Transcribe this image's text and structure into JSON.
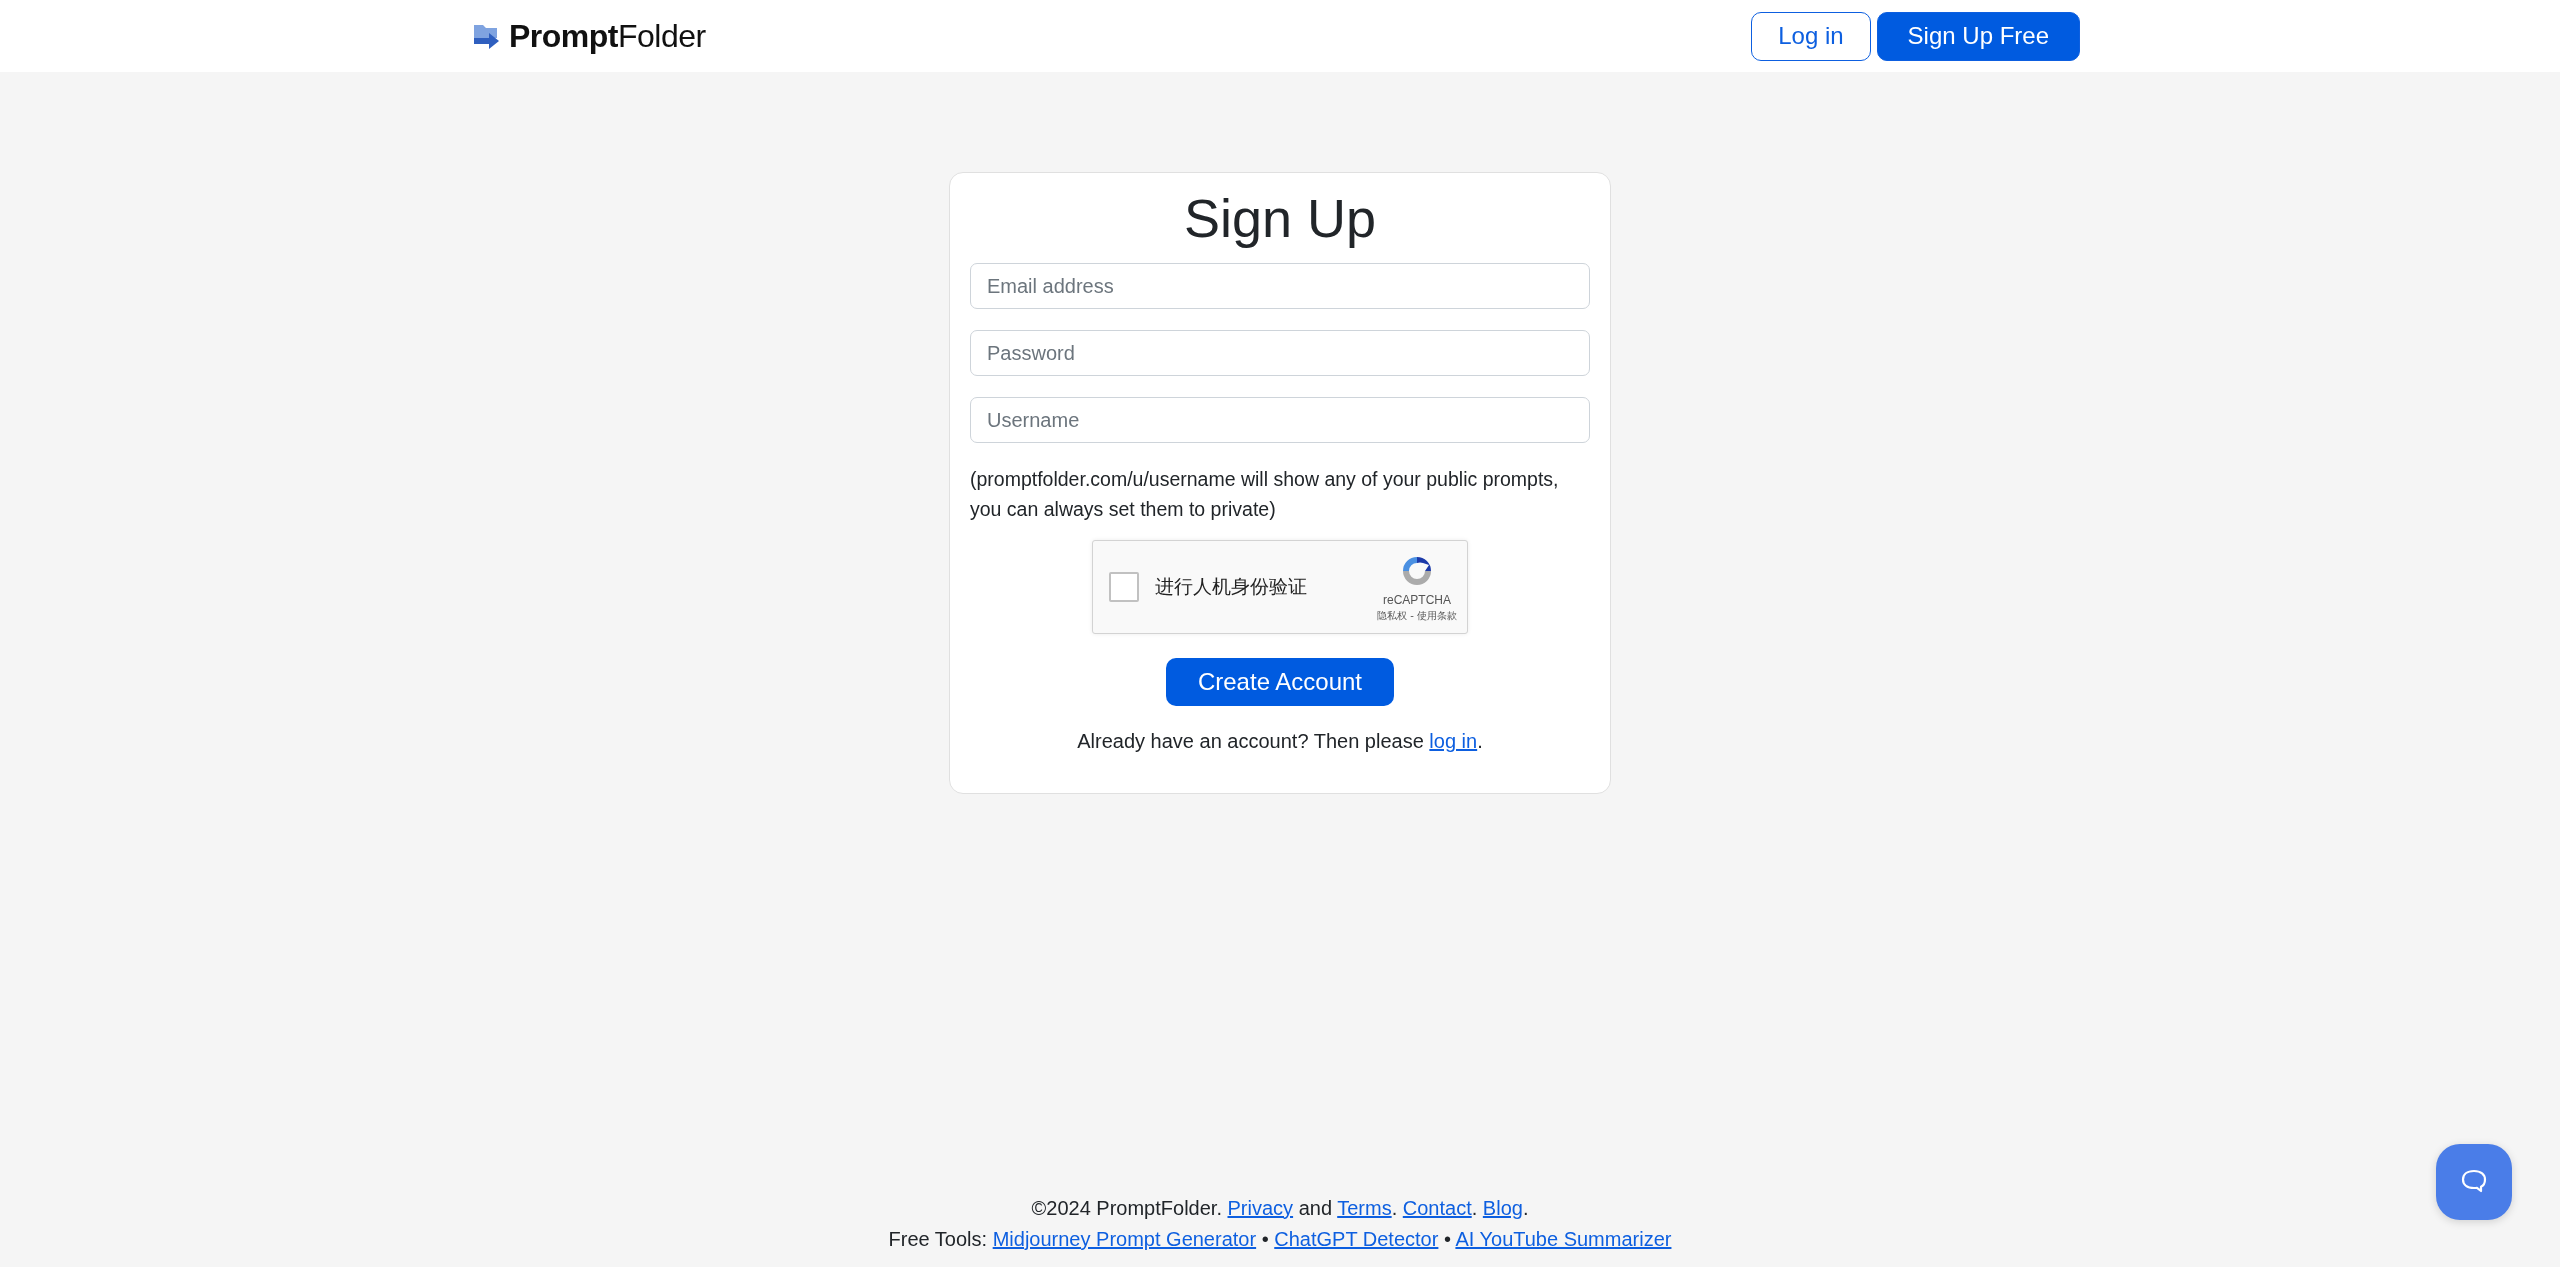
{
  "header": {
    "logo": "**Prompt**Folder",
    "buttons": [
      {
        "label": "Log in",
        "kind": "outline"
      },
      {
        "label": "Sign Up Free",
        "kind": "primary"
      }
    ]
  },
  "form": {
    "title": "Sign Up",
    "fields": [
      {
        "placeholder": "Email address"
      },
      {
        "placeholder": "Password"
      },
      {
        "placeholder": "Username"
      }
    ],
    "hint": "(promptfolder.com/u/username will show any of your public prompts, you can always set them to private)",
    "captcha": {
      "checked": false,
      "label": "进行人机身份验证",
      "brand": "reCAPTCHA",
      "legal": "隐私权 - 使用条款"
    },
    "submit": "Create Account",
    "login_prompt": [
      {
        "kind": "text",
        "text": "Already have an account? Then please "
      },
      {
        "kind": "link",
        "text": "log in"
      },
      {
        "kind": "text",
        "text": "."
      }
    ]
  },
  "footer": {
    "lines": [
      [
        {
          "kind": "text",
          "text": "©2024 PromptFolder. "
        },
        {
          "kind": "link",
          "text": "Privacy"
        },
        {
          "kind": "text",
          "text": " and "
        },
        {
          "kind": "link",
          "text": "Terms"
        },
        {
          "kind": "text",
          "text": ". "
        },
        {
          "kind": "link",
          "text": "Contact"
        },
        {
          "kind": "text",
          "text": ". "
        },
        {
          "kind": "link",
          "text": "Blog"
        },
        {
          "kind": "text",
          "text": "."
        }
      ],
      [
        {
          "kind": "text",
          "text": "Free Tools: "
        },
        {
          "kind": "link",
          "text": "Midjourney Prompt Generator"
        },
        {
          "kind": "text",
          "text": " • "
        },
        {
          "kind": "link",
          "text": "ChatGPT Detector"
        },
        {
          "kind": "text",
          "text": " • "
        },
        {
          "kind": "link",
          "text": "AI YouTube Summarizer"
        }
      ]
    ]
  }
}
